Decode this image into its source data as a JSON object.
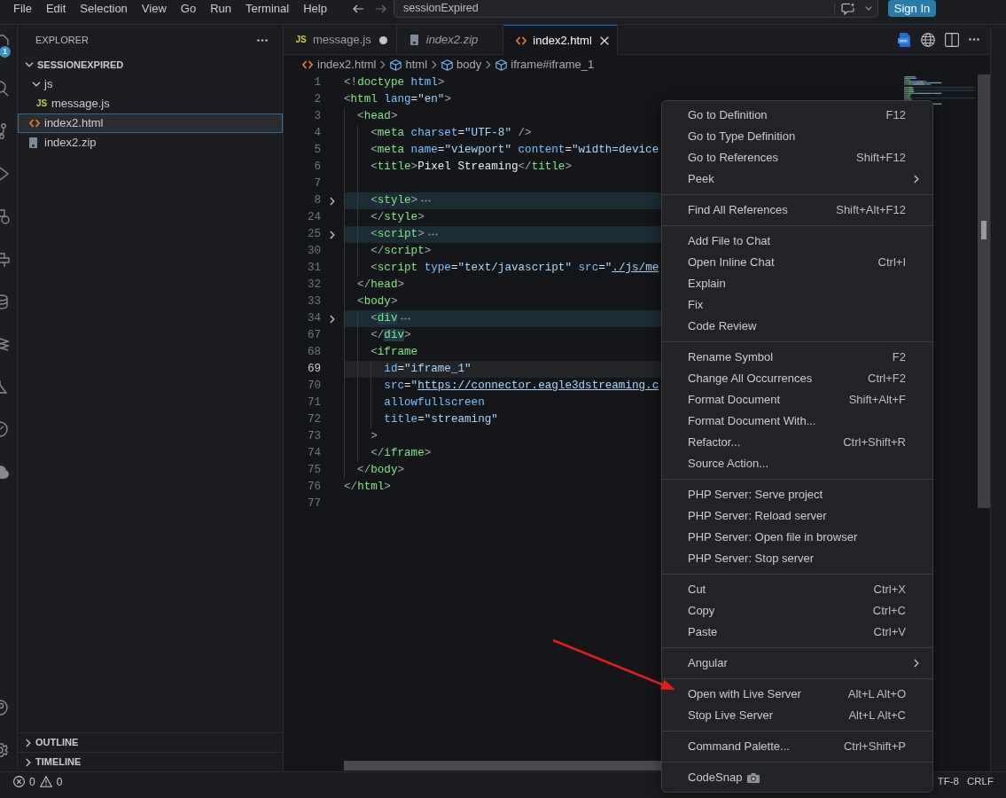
{
  "title_bar": {
    "menu": [
      "File",
      "Edit",
      "Selection",
      "View",
      "Go",
      "Run",
      "Terminal",
      "Help"
    ],
    "search": {
      "value": "sessionExpired"
    },
    "sign_in": "Sign In"
  },
  "activity_bar": {
    "badge": "1"
  },
  "sidebar": {
    "title": "EXPLORER",
    "tree": [
      {
        "label": "SESSIONEXPIRED",
        "kind": "folder",
        "expanded": true,
        "selected": false,
        "children": [
          {
            "label": "js",
            "kind": "folder",
            "expanded": true,
            "selected": false,
            "children": [
              {
                "label": "message.js",
                "kind": "script",
                "icon_label": "JS",
                "selected": false
              }
            ]
          },
          {
            "label": "index2.html",
            "kind": "markup",
            "selected": true
          },
          {
            "label": "index2.zip",
            "kind": "archive",
            "selected": false
          }
        ]
      }
    ],
    "panels": [
      {
        "label": "OUTLINE",
        "expanded": false
      },
      {
        "label": "TIMELINE",
        "expanded": false
      }
    ]
  },
  "tabs": [
    {
      "label": "message.js",
      "kind": "script",
      "icon_label": "JS",
      "selected": false,
      "modified": true,
      "preview": false
    },
    {
      "label": "index2.zip",
      "kind": "archive",
      "selected": false,
      "modified": false,
      "preview": true
    },
    {
      "label": "index2.html",
      "kind": "markup",
      "selected": true,
      "modified": false,
      "preview": false
    }
  ],
  "breadcrumbs": [
    {
      "label": "index2.html",
      "kind": "markup"
    },
    {
      "label": "html",
      "kind": "element"
    },
    {
      "label": "body",
      "kind": "element"
    },
    {
      "label": "iframe#iframe_1",
      "kind": "element"
    }
  ],
  "editor": {
    "lines": [
      {
        "number": "1",
        "folded": false,
        "current": false,
        "tokens": [
          {
            "kind": "punct",
            "text": "<!"
          },
          {
            "kind": "tag",
            "text": "doctype"
          },
          {
            "kind": "attr",
            "text": " html"
          },
          {
            "kind": "punct",
            "text": ">"
          }
        ]
      },
      {
        "number": "2",
        "folded": false,
        "current": false,
        "tokens": [
          {
            "kind": "punct",
            "text": "<"
          },
          {
            "kind": "tag",
            "text": "html"
          },
          {
            "kind": "attr",
            "text": " lang"
          },
          {
            "kind": "text",
            "text": "="
          },
          {
            "kind": "string",
            "text": "\"en\""
          },
          {
            "kind": "punct",
            "text": ">"
          }
        ]
      },
      {
        "number": "3",
        "folded": false,
        "current": false,
        "tokens": [
          {
            "kind": "punct",
            "text": "  <"
          },
          {
            "kind": "tag",
            "text": "head"
          },
          {
            "kind": "punct",
            "text": ">"
          }
        ]
      },
      {
        "number": "4",
        "folded": false,
        "current": false,
        "tokens": [
          {
            "kind": "punct",
            "text": "    <"
          },
          {
            "kind": "tag",
            "text": "meta"
          },
          {
            "kind": "attr",
            "text": " charset"
          },
          {
            "kind": "text",
            "text": "="
          },
          {
            "kind": "string",
            "text": "\"UTF-8\""
          },
          {
            "kind": "punct",
            "text": " />"
          }
        ]
      },
      {
        "number": "5",
        "folded": false,
        "current": false,
        "tokens": [
          {
            "kind": "punct",
            "text": "    <"
          },
          {
            "kind": "tag",
            "text": "meta"
          },
          {
            "kind": "attr",
            "text": " name"
          },
          {
            "kind": "text",
            "text": "="
          },
          {
            "kind": "string",
            "text": "\"viewport\""
          },
          {
            "kind": "attr",
            "text": " content"
          },
          {
            "kind": "text",
            "text": "="
          },
          {
            "kind": "string",
            "text": "\"width=device"
          }
        ]
      },
      {
        "number": "6",
        "folded": false,
        "current": false,
        "tokens": [
          {
            "kind": "punct",
            "text": "    <"
          },
          {
            "kind": "tag",
            "text": "title"
          },
          {
            "kind": "punct",
            "text": ">"
          },
          {
            "kind": "text",
            "text": "Pixel Streaming"
          },
          {
            "kind": "punct",
            "text": "</"
          },
          {
            "kind": "tag",
            "text": "title"
          },
          {
            "kind": "punct",
            "text": ">"
          }
        ]
      },
      {
        "number": "7",
        "current": false
      },
      {
        "number": "8",
        "folded": true,
        "current": false,
        "tokens": [
          {
            "kind": "punct",
            "text": "    <"
          },
          {
            "kind": "tag",
            "text": "style"
          },
          {
            "kind": "punct",
            "text": ">"
          }
        ]
      },
      {
        "number": "24",
        "folded": false,
        "current": false,
        "tokens": [
          {
            "kind": "punct",
            "text": "    </"
          },
          {
            "kind": "tag",
            "text": "style"
          },
          {
            "kind": "punct",
            "text": ">"
          }
        ]
      },
      {
        "number": "25",
        "folded": true,
        "current": false,
        "tokens": [
          {
            "kind": "punct",
            "text": "    <"
          },
          {
            "kind": "tag",
            "text": "script"
          },
          {
            "kind": "punct",
            "text": ">"
          }
        ]
      },
      {
        "number": "30",
        "folded": false,
        "current": false,
        "tokens": [
          {
            "kind": "punct",
            "text": "    </"
          },
          {
            "kind": "tag",
            "text": "script"
          },
          {
            "kind": "punct",
            "text": ">"
          }
        ]
      },
      {
        "number": "31",
        "folded": false,
        "current": false,
        "tokens": [
          {
            "kind": "punct",
            "text": "    <"
          },
          {
            "kind": "tag",
            "text": "script"
          },
          {
            "kind": "attr",
            "text": " type"
          },
          {
            "kind": "text",
            "text": "="
          },
          {
            "kind": "string",
            "text": "\"text/javascript\""
          },
          {
            "kind": "attr",
            "text": " src"
          },
          {
            "kind": "text",
            "text": "="
          },
          {
            "kind": "string",
            "text": "\""
          },
          {
            "kind": "link",
            "text": "./js/me"
          }
        ]
      },
      {
        "number": "32",
        "folded": false,
        "current": false,
        "tokens": [
          {
            "kind": "punct",
            "text": "  </"
          },
          {
            "kind": "tag",
            "text": "head"
          },
          {
            "kind": "punct",
            "text": ">"
          }
        ]
      },
      {
        "number": "33",
        "folded": false,
        "current": false,
        "tokens": [
          {
            "kind": "punct",
            "text": "  <"
          },
          {
            "kind": "tag",
            "text": "body"
          },
          {
            "kind": "punct",
            "text": ">"
          }
        ]
      },
      {
        "number": "34",
        "folded": true,
        "current": false,
        "tokens": [
          {
            "kind": "punct",
            "text": "    <"
          },
          {
            "kind": "match",
            "text": "div"
          }
        ]
      },
      {
        "number": "67",
        "folded": false,
        "current": false,
        "tokens": [
          {
            "kind": "punct",
            "text": "    </"
          },
          {
            "kind": "match",
            "text": "div"
          },
          {
            "kind": "punct",
            "text": ">"
          }
        ]
      },
      {
        "number": "68",
        "folded": false,
        "current": false,
        "tokens": [
          {
            "kind": "punct",
            "text": "    <"
          },
          {
            "kind": "tag",
            "text": "iframe"
          }
        ]
      },
      {
        "number": "69",
        "folded": false,
        "current": true,
        "tokens": [
          {
            "kind": "attr",
            "text": "      id"
          },
          {
            "kind": "text",
            "text": "="
          },
          {
            "kind": "string",
            "text": "\"iframe_1\""
          }
        ]
      },
      {
        "number": "70",
        "folded": false,
        "current": false,
        "tokens": [
          {
            "kind": "attr",
            "text": "      src"
          },
          {
            "kind": "text",
            "text": "="
          },
          {
            "kind": "string",
            "text": "\""
          },
          {
            "kind": "link",
            "text": "https://connector.eagle3dstreaming.c"
          }
        ]
      },
      {
        "number": "71",
        "folded": false,
        "current": false,
        "tokens": [
          {
            "kind": "attr",
            "text": "      allowfullscreen"
          }
        ]
      },
      {
        "number": "72",
        "folded": false,
        "current": false,
        "tokens": [
          {
            "kind": "attr",
            "text": "      title"
          },
          {
            "kind": "text",
            "text": "="
          },
          {
            "kind": "string",
            "text": "\"streaming\""
          }
        ]
      },
      {
        "number": "73",
        "folded": false,
        "current": false,
        "tokens": [
          {
            "kind": "punct",
            "text": "    >"
          }
        ]
      },
      {
        "number": "74",
        "folded": false,
        "current": false,
        "tokens": [
          {
            "kind": "punct",
            "text": "    </"
          },
          {
            "kind": "tag",
            "text": "iframe"
          },
          {
            "kind": "punct",
            "text": ">"
          }
        ]
      },
      {
        "number": "75",
        "folded": false,
        "current": false,
        "tokens": [
          {
            "kind": "punct",
            "text": "  </"
          },
          {
            "kind": "tag",
            "text": "body"
          },
          {
            "kind": "punct",
            "text": ">"
          }
        ]
      },
      {
        "number": "76",
        "folded": false,
        "current": false,
        "tokens": [
          {
            "kind": "punct",
            "text": "</"
          },
          {
            "kind": "tag",
            "text": "html"
          },
          {
            "kind": "punct",
            "text": ">"
          }
        ]
      },
      {
        "number": "77",
        "current": false
      }
    ]
  },
  "context_menu": {
    "groups": [
      [
        {
          "label": "Go to Definition",
          "shortcut": "F12",
          "kind": "command"
        },
        {
          "label": "Go to Type Definition",
          "kind": "command"
        },
        {
          "label": "Go to References",
          "shortcut": "Shift+F12",
          "kind": "command"
        },
        {
          "label": "Peek",
          "kind": "submenu"
        }
      ],
      [
        {
          "label": "Find All References",
          "shortcut": "Shift+Alt+F12",
          "kind": "command"
        }
      ],
      [
        {
          "label": "Add File to Chat",
          "kind": "command"
        },
        {
          "label": "Open Inline Chat",
          "shortcut": "Ctrl+I",
          "kind": "command"
        },
        {
          "label": "Explain",
          "kind": "command"
        },
        {
          "label": "Fix",
          "kind": "command"
        },
        {
          "label": "Code Review",
          "kind": "command"
        }
      ],
      [
        {
          "label": "Rename Symbol",
          "shortcut": "F2",
          "kind": "command"
        },
        {
          "label": "Change All Occurrences",
          "shortcut": "Ctrl+F2",
          "kind": "command"
        },
        {
          "label": "Format Document",
          "shortcut": "Shift+Alt+F",
          "kind": "command"
        },
        {
          "label": "Format Document With...",
          "kind": "command"
        },
        {
          "label": "Refactor...",
          "shortcut": "Ctrl+Shift+R",
          "kind": "command"
        },
        {
          "label": "Source Action...",
          "kind": "command"
        }
      ],
      [
        {
          "label": "PHP Server: Serve project",
          "kind": "command"
        },
        {
          "label": "PHP Server: Reload server",
          "kind": "command"
        },
        {
          "label": "PHP Server: Open file in browser",
          "kind": "command"
        },
        {
          "label": "PHP Server: Stop server",
          "kind": "command"
        }
      ],
      [
        {
          "label": "Cut",
          "shortcut": "Ctrl+X",
          "kind": "command"
        },
        {
          "label": "Copy",
          "shortcut": "Ctrl+C",
          "kind": "command"
        },
        {
          "label": "Paste",
          "shortcut": "Ctrl+V",
          "kind": "command"
        }
      ],
      [
        {
          "label": "Angular",
          "kind": "submenu"
        }
      ],
      [
        {
          "label": "Open with Live Server",
          "shortcut": "Alt+L Alt+O",
          "kind": "command"
        },
        {
          "label": "Stop Live Server",
          "shortcut": "Alt+L Alt+C",
          "kind": "command"
        }
      ],
      [
        {
          "label": "Command Palette...",
          "shortcut": "Ctrl+Shift+P",
          "kind": "command"
        }
      ],
      [
        {
          "label": "CodeSnap",
          "kind": "decorated"
        }
      ]
    ]
  },
  "status_bar": {
    "errors": "0",
    "warnings": "0",
    "encoding": "TF-8",
    "line_ending": "CRLF"
  }
}
